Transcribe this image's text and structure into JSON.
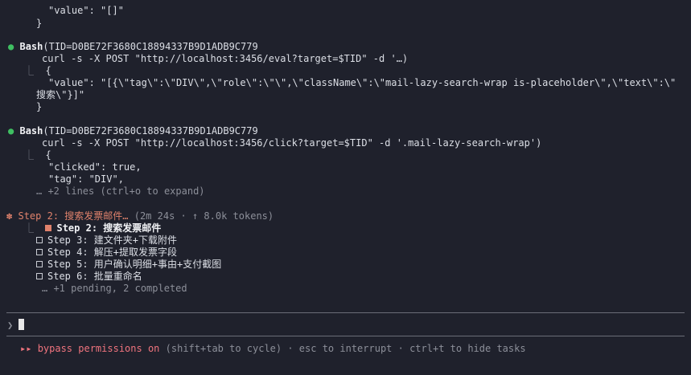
{
  "output_top": {
    "value_line": "\"value\": \"[]\"",
    "close_brace": "}"
  },
  "tool_call_1": {
    "tool": "Bash",
    "args": "(TID=D0BE72F3680C18894337B9D1ADB9C779",
    "command": "curl -s -X POST \"http://localhost:3456/eval?target=$TID\" -d '…)",
    "result_open": "{",
    "result_value_line1": "\"value\": \"[{\\\"tag\\\":\\\"DIV\\\",\\\"role\\\":\\\"\\\",\\\"className\\\":\\\"mail-lazy-search-wrap is-placeholder\\\",\\\"text\\\":\\\"",
    "result_value_line2": "搜索\\\"}]\"",
    "result_close": "}"
  },
  "tool_call_2": {
    "tool": "Bash",
    "args": "(TID=D0BE72F3680C18894337B9D1ADB9C779",
    "command": "curl -s -X POST \"http://localhost:3456/click?target=$TID\" -d '.mail-lazy-search-wrap')",
    "result_open": "{",
    "result_line1": "\"clicked\": true,",
    "result_line2": "\"tag\": \"DIV\",",
    "collapsed_hint": "… +2 lines (ctrl+o to expand)"
  },
  "task_status": {
    "spinner": "✽",
    "title": "Step 2: 搜索发票邮件…",
    "meta": "(2m 24s · ↑ 8.0k tokens)",
    "tasks": [
      {
        "label": "Step 2: 搜索发票邮件",
        "state": "in_progress"
      },
      {
        "label": "Step 3: 建文件夹+下载附件",
        "state": "pending"
      },
      {
        "label": "Step 4: 解压+提取发票字段",
        "state": "pending"
      },
      {
        "label": "Step 5: 用户确认明细+事由+支付截图",
        "state": "pending"
      },
      {
        "label": "Step 6: 批量重命名",
        "state": "pending"
      }
    ],
    "summary": "… +1 pending, 2 completed"
  },
  "prompt": {
    "symbol": "❯",
    "input_value": ""
  },
  "status_bar": {
    "arrows": "▸▸",
    "mode": "bypass permissions on",
    "hint": "(shift+tab to cycle) · esc to interrupt · ctrl+t to hide tasks"
  },
  "colors": {
    "background": "#1f212c",
    "bullet_green": "#3fbf62",
    "spinner_orange": "#e0826c",
    "mode_pink": "#f0747e"
  }
}
